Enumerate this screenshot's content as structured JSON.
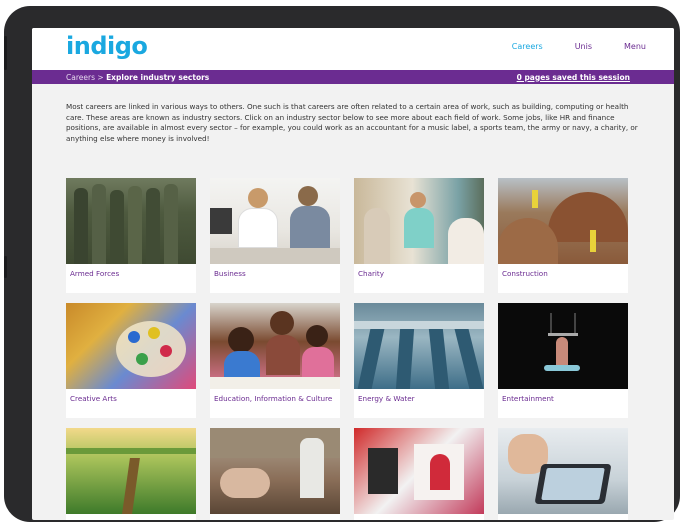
{
  "header": {
    "logo": "indigo",
    "nav": [
      {
        "label": "Careers",
        "active": true
      },
      {
        "label": "Unis",
        "active": false
      },
      {
        "label": "Menu",
        "active": false
      }
    ]
  },
  "breadcrumb": {
    "parent": "Careers",
    "separator": ">",
    "current": "Explore industry sectors",
    "saved_link": "0 pages saved this session"
  },
  "intro": "Most careers are linked in various ways to others. One such is that careers are often related to a certain area of work, such as building, computing or health care. These areas are known as industry sectors. Click on an industry sector below to see more about each field of work. Some jobs, like HR and finance positions, are available in almost every sector – for example, you could work as an accountant for a music label, a sports team, the army or navy, a charity, or anything else where money is involved!",
  "sectors": [
    {
      "label": "Armed Forces"
    },
    {
      "label": "Business"
    },
    {
      "label": "Charity"
    },
    {
      "label": "Construction"
    },
    {
      "label": "Creative Arts"
    },
    {
      "label": "Education, Information & Culture"
    },
    {
      "label": "Energy & Water"
    },
    {
      "label": "Entertainment"
    }
  ],
  "colors": {
    "brand_purple": "#6b2c91",
    "brand_blue": "#1aa8e0",
    "device_frame": "#2a2a2c"
  }
}
